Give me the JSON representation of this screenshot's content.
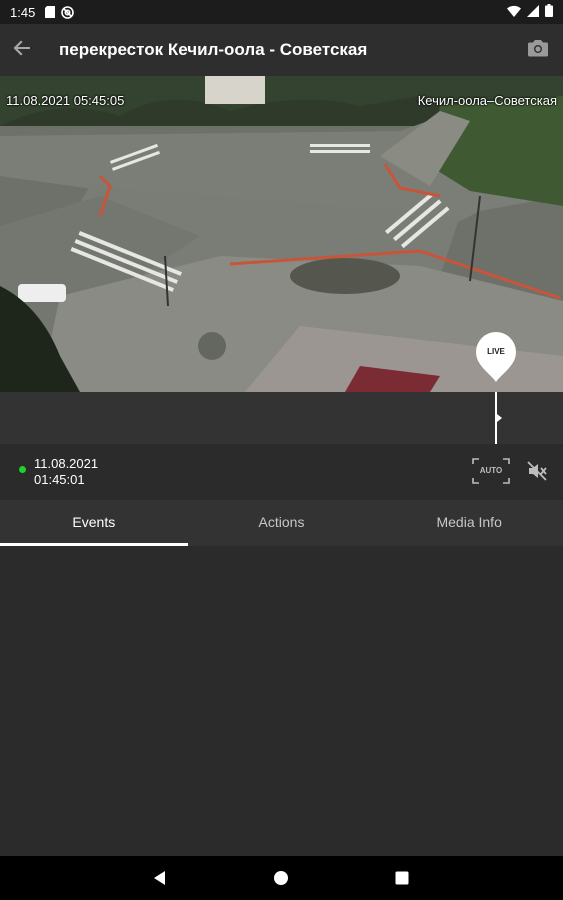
{
  "status_bar": {
    "time": "1:45",
    "icons": [
      "sd-card-icon",
      "at-sign-icon",
      "wifi-icon",
      "cell-signal-icon",
      "battery-icon"
    ]
  },
  "app_bar": {
    "title": "перекресток Кечил-оола - Советская",
    "back_icon": "arrow-back-icon",
    "snapshot_icon": "camera-icon"
  },
  "video": {
    "timestamp": "11.08.2021  05:45:05",
    "camera_label": "Кечил-оола–Советская",
    "live_label": "LIVE"
  },
  "playback": {
    "date": "11.08.2021",
    "time": "01:45:01",
    "auto_label": "AUTO",
    "status_color": "#1fd12f"
  },
  "tabs": [
    {
      "label": "Events",
      "active": true
    },
    {
      "label": "Actions",
      "active": false
    },
    {
      "label": "Media Info",
      "active": false
    }
  ],
  "colors": {
    "app_bar": "#2e2e2e",
    "background": "#2b2b2b",
    "accent": "#ffffff"
  }
}
